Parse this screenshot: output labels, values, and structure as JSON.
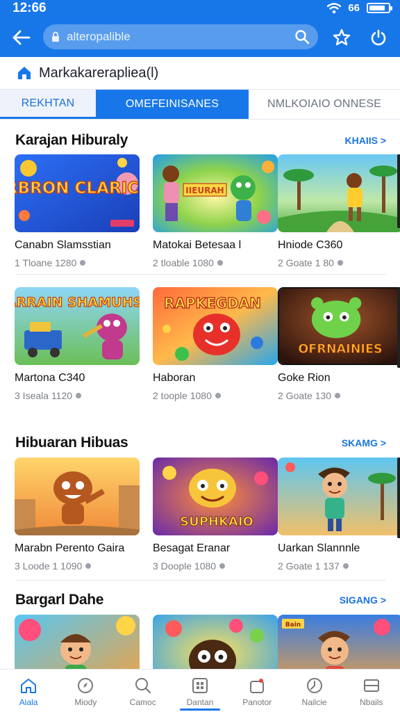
{
  "status": {
    "time": "12:66",
    "network": "66"
  },
  "browser": {
    "url": "alteropalible"
  },
  "page": {
    "title": "Markakarerapliea(l)"
  },
  "tabs": [
    {
      "label": "REKHTAN"
    },
    {
      "label": "OMEFEINISANES"
    },
    {
      "label": "NMLKOIAIO ONNESE"
    }
  ],
  "sections": [
    {
      "title": "Karajan Hiburaly",
      "link": "KHAIIS >",
      "rows": [
        [
          {
            "name": "Canabn Slamsstian",
            "meta": "1 Tloane 1280",
            "art": "EERBRON CLARICIAN"
          },
          {
            "name": "Matokai Betesaa l",
            "meta": "2 tloable 1080",
            "art": "IIEURAH"
          },
          {
            "name": "Hniode C360",
            "meta": "2 Goate 1 80",
            "art": ""
          }
        ],
        [
          {
            "name": "Martona C340",
            "meta": "3 Iseala 1120",
            "art": "HARRAIN SHAMUHS"
          },
          {
            "name": "Haboran",
            "meta": "2 toople 1080",
            "art": "RAPKEGDAN"
          },
          {
            "name": "Goke Rion",
            "meta": "2 Goate 130",
            "art": "OFRNAINIES"
          }
        ]
      ]
    },
    {
      "title": "Hibuaran Hibuas",
      "link": "SKAMG >",
      "rows": [
        [
          {
            "name": "Marabn Perento Gaira",
            "meta": "3 Loode 1 1090",
            "art": ""
          },
          {
            "name": "Besagat Eranar",
            "meta": "3 Doople 1080",
            "art": "SUPHKAIO"
          },
          {
            "name": "Uarkan Slannnle",
            "meta": "2 Goate 1 137",
            "art": ""
          }
        ]
      ]
    },
    {
      "title": "Bargarl Dahe",
      "link": "SIGANG >",
      "rows": [
        [
          {
            "name": "",
            "meta": "",
            "art": ""
          },
          {
            "name": "",
            "meta": "",
            "art": ""
          },
          {
            "name": "",
            "meta": "",
            "art": "Bain"
          }
        ]
      ]
    }
  ],
  "bottom_nav": [
    {
      "label": "Aiala",
      "icon": "home-icon",
      "active": true
    },
    {
      "label": "Miody",
      "icon": "compass-icon"
    },
    {
      "label": "Camoc",
      "icon": "search-icon"
    },
    {
      "label": "Dantan",
      "icon": "grid-icon"
    },
    {
      "label": "Panotor",
      "icon": "bag-icon"
    },
    {
      "label": "Nailcie",
      "icon": "clock-icon"
    },
    {
      "label": "Nbails",
      "icon": "menu-icon"
    }
  ],
  "colors": {
    "brand": "#1877e8",
    "link": "#1a74e0",
    "meta_gray": "#7c7f86"
  }
}
